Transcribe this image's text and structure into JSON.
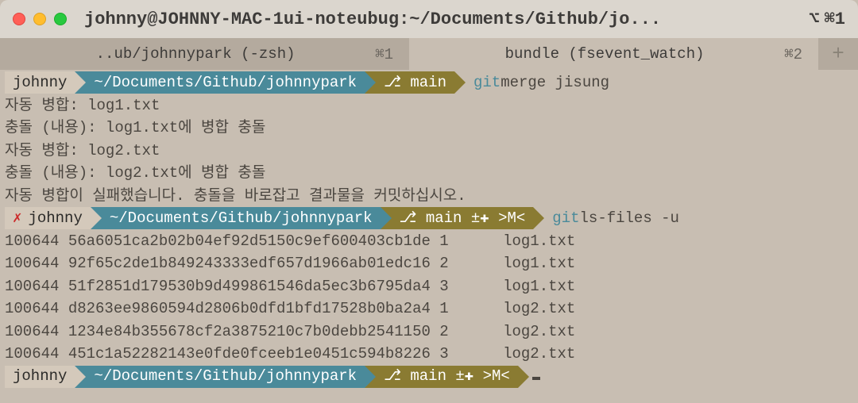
{
  "window": {
    "title": "johnny@JOHNNY-MAC-1ui-noteubug:~/Documents/Github/jo...",
    "shortcut": "⌘1"
  },
  "tabs": [
    {
      "label": "..ub/johnnypark (-zsh)",
      "shortcut": "⌘1",
      "active": false
    },
    {
      "label": "bundle (fsevent_watch)",
      "shortcut": "⌘2",
      "active": true
    }
  ],
  "prompts": [
    {
      "user": "johnny",
      "err": false,
      "path": "~/Documents/Github/johnnypark",
      "branch": "⎇ main",
      "cmd_git": "git",
      "cmd_rest": " merge jisung"
    },
    {
      "user": "johnny",
      "err": true,
      "err_mark": "✗",
      "path": "~/Documents/Github/johnnypark",
      "branch": "⎇ main ±✚ >M<",
      "cmd_git": "git",
      "cmd_rest": " ls-files -u"
    },
    {
      "user": "johnny",
      "err": false,
      "path": "~/Documents/Github/johnnypark",
      "branch": "⎇ main ±✚ >M<",
      "cmd_git": "",
      "cmd_rest": ""
    }
  ],
  "output1": [
    "자동 병합: log1.txt",
    "충돌 (내용): log1.txt에 병합 충돌",
    "자동 병합: log2.txt",
    "충돌 (내용): log2.txt에 병합 충돌",
    "자동 병합이 실패했습니다. 충돌을 바로잡고 결과물을 커밋하십시오."
  ],
  "lsfiles": [
    {
      "mode": "100644",
      "sha": "56a6051ca2b02b04ef92d5150c9ef600403cb1de",
      "stage": "1",
      "file": "log1.txt"
    },
    {
      "mode": "100644",
      "sha": "92f65c2de1b849243333edf657d1966ab01edc16",
      "stage": "2",
      "file": "log1.txt"
    },
    {
      "mode": "100644",
      "sha": "51f2851d179530b9d499861546da5ec3b6795da4",
      "stage": "3",
      "file": "log1.txt"
    },
    {
      "mode": "100644",
      "sha": "d8263ee9860594d2806b0dfd1bfd17528b0ba2a4",
      "stage": "1",
      "file": "log2.txt"
    },
    {
      "mode": "100644",
      "sha": "1234e84b355678cf2a3875210c7b0debb2541150",
      "stage": "2",
      "file": "log2.txt"
    },
    {
      "mode": "100644",
      "sha": "451c1a52282143e0fde0fceeb1e0451c594b8226",
      "stage": "3",
      "file": "log2.txt"
    }
  ],
  "add_tab": "+",
  "alt_icon": "⌥"
}
